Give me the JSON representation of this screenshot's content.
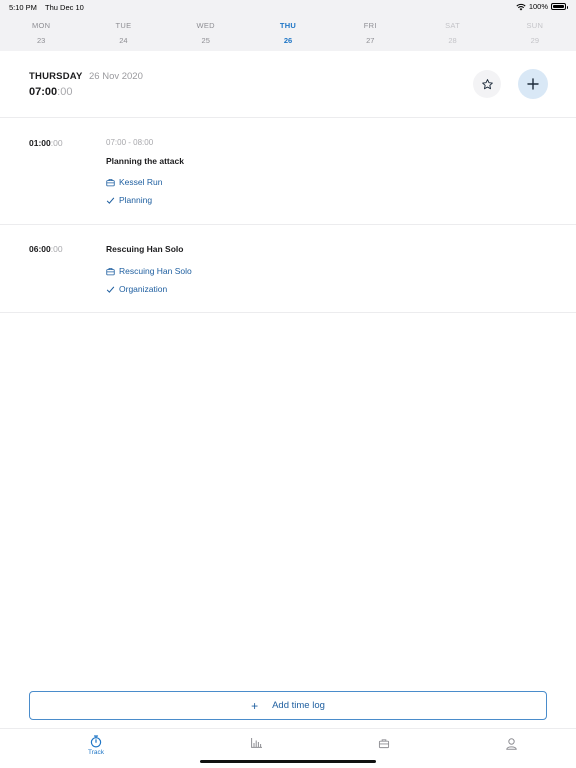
{
  "status_bar": {
    "time": "5:10 PM",
    "date": "Thu Dec 10",
    "battery": "100%"
  },
  "week": [
    {
      "name": "MON",
      "date": "23",
      "state": "past"
    },
    {
      "name": "TUE",
      "date": "24",
      "state": "past"
    },
    {
      "name": "WED",
      "date": "25",
      "state": "past"
    },
    {
      "name": "THU",
      "date": "26",
      "state": "active"
    },
    {
      "name": "FRI",
      "date": "27",
      "state": "past"
    },
    {
      "name": "SAT",
      "date": "28",
      "state": "future"
    },
    {
      "name": "SUN",
      "date": "29",
      "state": "future"
    }
  ],
  "header": {
    "day": "THURSDAY",
    "date": "26 Nov 2020",
    "total_hm": "07:00",
    "total_sec": ":00"
  },
  "entries": [
    {
      "duration_hm": "01:00",
      "duration_sec": ":00",
      "range": "07:00 - 08:00",
      "title": "Planning the attack",
      "project": "Kessel Run",
      "task": "Planning"
    },
    {
      "duration_hm": "06:00",
      "duration_sec": ":00",
      "range": "",
      "title": "Rescuing Han Solo",
      "project": "Rescuing Han Solo",
      "task": "Organization"
    }
  ],
  "actions": {
    "add_time_log": "Add time log",
    "add_plus": "+"
  },
  "tabs": {
    "track": "Track"
  },
  "colors": {
    "accent": "#1f76c6",
    "link": "#1f5fa0",
    "week_bg": "#f2f2f4"
  }
}
